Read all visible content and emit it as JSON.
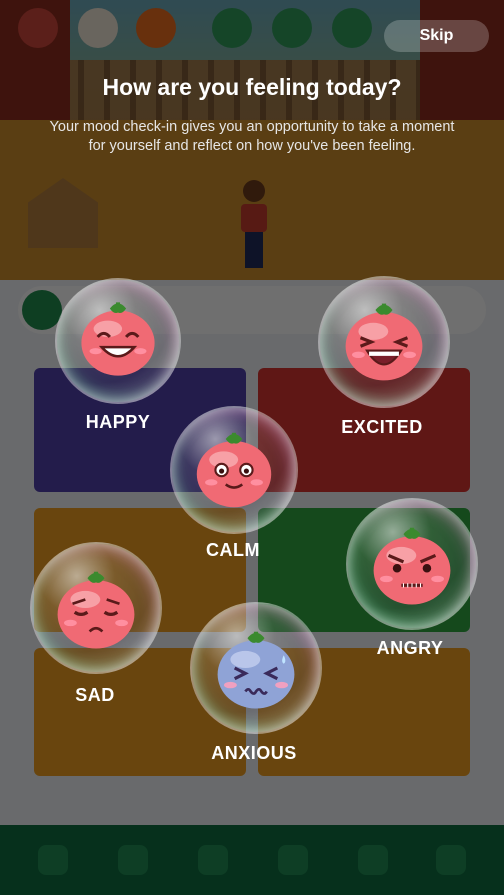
{
  "overlay": {
    "skip_label": "Skip",
    "title": "How are you feeling today?",
    "subtitle": "Your mood check-in gives you an opportunity to take a moment for yourself and reflect on how you've been feeling."
  },
  "moods": [
    {
      "id": "happy",
      "label": "HAPPY",
      "icon": "happy-tomato-icon"
    },
    {
      "id": "excited",
      "label": "EXCITED",
      "icon": "excited-tomato-icon"
    },
    {
      "id": "calm",
      "label": "CALM",
      "icon": "calm-tomato-icon"
    },
    {
      "id": "angry",
      "label": "ANGRY",
      "icon": "angry-tomato-icon"
    },
    {
      "id": "sad",
      "label": "SAD",
      "icon": "sad-tomato-icon"
    },
    {
      "id": "anxious",
      "label": "ANXIOUS",
      "icon": "anxious-tomato-icon"
    }
  ],
  "colors": {
    "tomato": "#f06a74",
    "anxious_face": "#8fa3d6",
    "stem": "#3b8a2e",
    "nav_bar": "#0e6b3e"
  }
}
